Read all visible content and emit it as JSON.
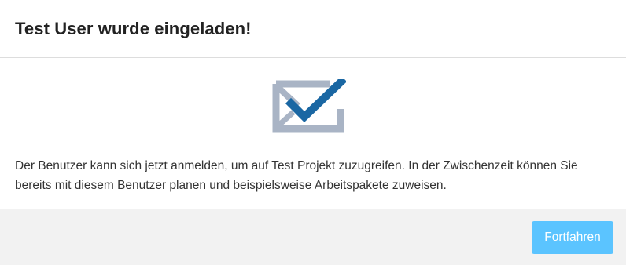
{
  "dialog": {
    "title": "Test User wurde eingeladen!",
    "message": "Der Benutzer kann sich jetzt anmelden, um auf Test Projekt zuzugreifen. In der Zwischenzeit können Sie bereits mit diesem Benutzer planen und beispielsweise Arbeitspakete zuweisen.",
    "illustration_icon": "envelope-check-icon",
    "continue_label": "Fortfahren"
  },
  "colors": {
    "envelope": "#a9b4c5",
    "checkmark": "#1a67a3",
    "button": "#5bc4ff",
    "footer_bg": "#f2f2f2"
  }
}
